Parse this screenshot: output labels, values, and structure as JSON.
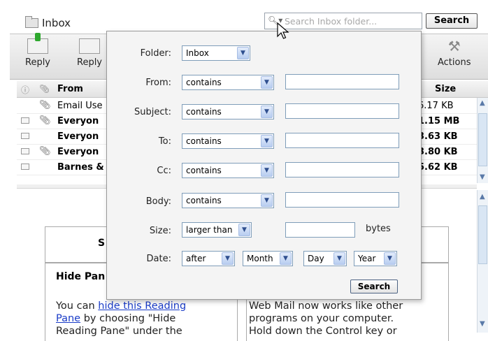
{
  "header": {
    "folder_title": "Inbox",
    "search_placeholder": "Search Inbox folder...",
    "search_button": "Search"
  },
  "toolbar": {
    "reply": "Reply",
    "reply_all": "Reply",
    "actions": "Actions"
  },
  "message_list": {
    "columns": {
      "from": "From",
      "size": "Size"
    },
    "rows": [
      {
        "from": "Email Use",
        "size": "6.17 KB",
        "bold": false,
        "attachment": true
      },
      {
        "from": "Everyon",
        "size": "1.15 MB",
        "bold": true,
        "attachment": true
      },
      {
        "from": "Everyon",
        "size": "3.63 KB",
        "bold": true,
        "attachment": false
      },
      {
        "from": "Everyon",
        "size": "3.80 KB",
        "bold": true,
        "attachment": true
      },
      {
        "from": "Barnes &",
        "size": "5.62 KB",
        "bold": true,
        "attachment": false
      }
    ]
  },
  "reading_pane": {
    "heading_fragment": "S",
    "hide_heading": "Hide Pan",
    "left_text_1": "You can ",
    "left_link": "hide this Reading",
    "left_link_2": "Pane",
    "left_text_2": " by choosing \"Hide",
    "left_text_3": "Reading Pane\" under the",
    "right_text_1": "Web Mail now works like other",
    "right_text_2": "programs on your computer.",
    "right_text_3": "Hold down the Control key or"
  },
  "advanced_search": {
    "folder_label": "Folder:",
    "folder_value": "Inbox",
    "from_label": "From:",
    "subject_label": "Subject:",
    "to_label": "To:",
    "cc_label": "Cc:",
    "body_label": "Body:",
    "size_label": "Size:",
    "date_label": "Date:",
    "contains": "contains",
    "size_value": "larger than",
    "bytes": "bytes",
    "date_value": "after",
    "month": "Month",
    "day": "Day",
    "year": "Year",
    "search_button": "Search"
  }
}
